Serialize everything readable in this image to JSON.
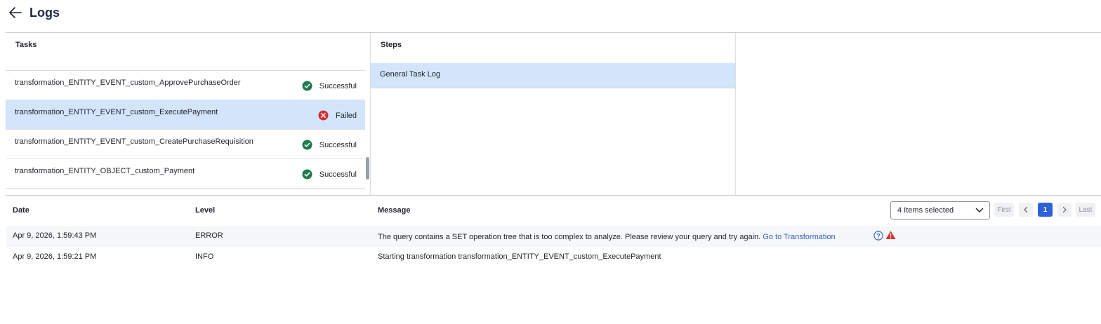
{
  "header": {
    "title": "Logs",
    "back_icon": "arrow-left-icon"
  },
  "tasks_panel": {
    "header": "Tasks",
    "items": [
      {
        "name": "transformation_ENTITY_EVENT_custom_ApprovePurchaseOrder",
        "status": "Successful",
        "status_icon": "check-circle-icon",
        "selected": false
      },
      {
        "name": "transformation_ENTITY_EVENT_custom_ExecutePayment",
        "status": "Failed",
        "status_icon": "error-circle-icon",
        "selected": true
      },
      {
        "name": "transformation_ENTITY_EVENT_custom_CreatePurchaseRequisition",
        "status": "Successful",
        "status_icon": "check-circle-icon",
        "selected": false
      },
      {
        "name": "transformation_ENTITY_OBJECT_custom_Payment",
        "status": "Successful",
        "status_icon": "check-circle-icon",
        "selected": false
      }
    ]
  },
  "steps_panel": {
    "header": "Steps",
    "items": [
      {
        "label": "General Task Log",
        "selected": true
      }
    ]
  },
  "logs_table": {
    "columns": {
      "date": "Date",
      "level": "Level",
      "message": "Message"
    },
    "filter": {
      "value": "4 Items selected",
      "icon": "chevron-down-icon"
    },
    "pagination": {
      "first": "First",
      "prev_icon": "chevron-left-icon",
      "current": "1",
      "next_icon": "chevron-right-icon",
      "last": "Last"
    },
    "rows": [
      {
        "date": "Apr 9, 2026, 1:59:43 PM",
        "level": "ERROR",
        "message": "The query contains a SET operation tree that is too complex to analyze. Please review your query and try again.",
        "link": "Go to Transformation",
        "help_icon": "question-circle-icon",
        "warn_icon": "warning-triangle-icon"
      },
      {
        "date": "Apr 9, 2026, 1:59:21 PM",
        "level": "INFO",
        "message": "Starting transformation transformation_ENTITY_EVENT_custom_ExecutePayment"
      }
    ]
  },
  "colors": {
    "selected_row": "#d3e5fb",
    "success": "#1e7a4f",
    "error": "#d32f2f",
    "link": "#2f5fc4",
    "page_active": "#2962d9"
  }
}
